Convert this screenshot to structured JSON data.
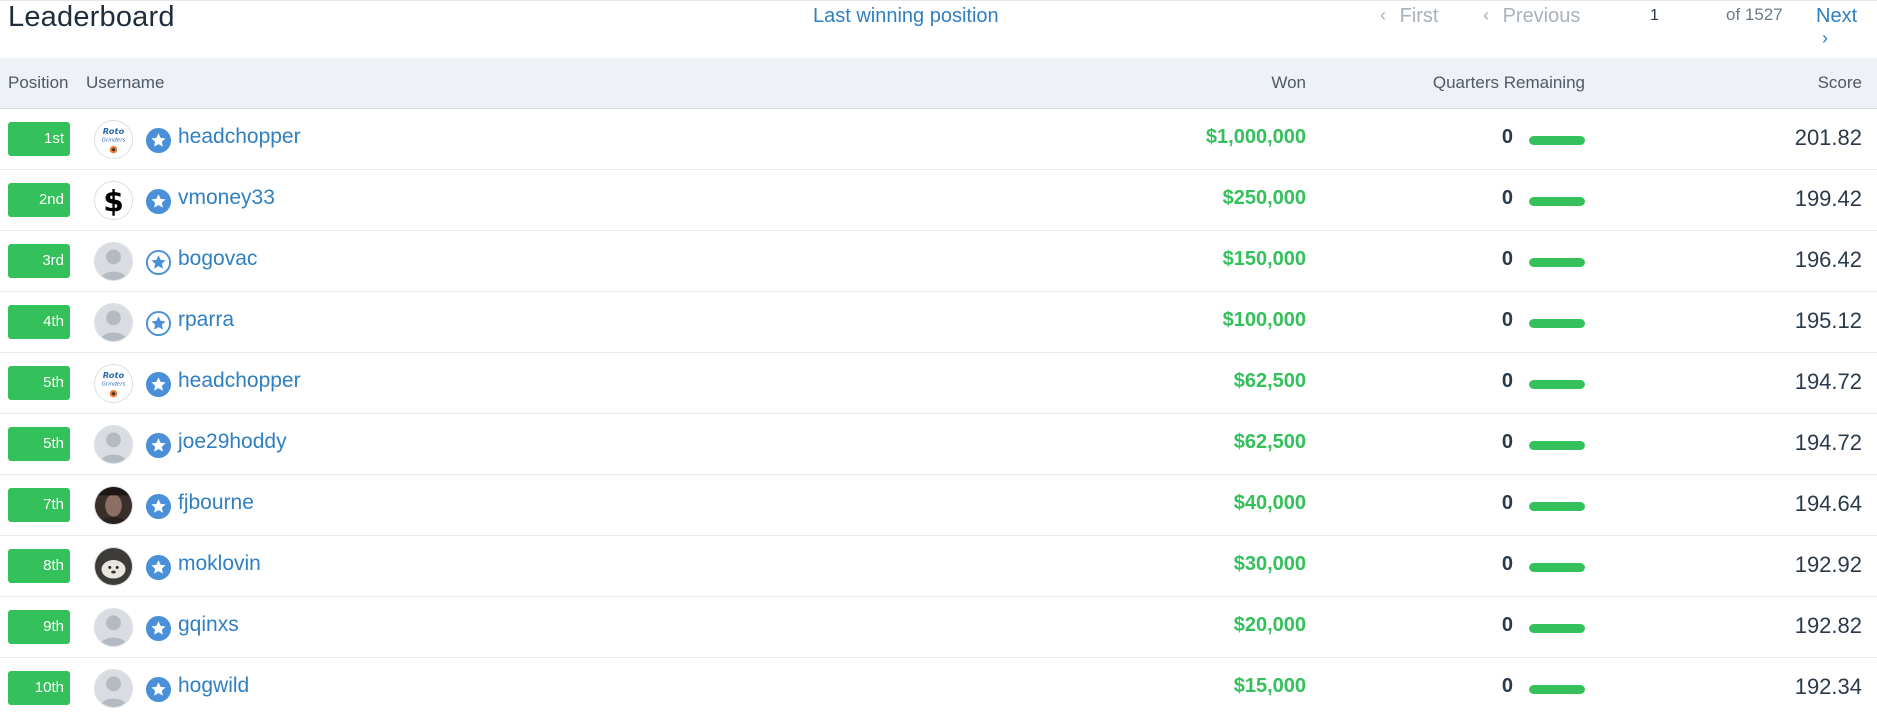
{
  "header": {
    "title": "Leaderboard",
    "last_winning_position": "Last winning position",
    "first_label": "First",
    "previous_label": "Previous",
    "page_value": "1",
    "of_label": "of 1527",
    "next_label": "Next"
  },
  "columns": {
    "position": "Position",
    "username": "Username",
    "won": "Won",
    "quarters_remaining": "Quarters Remaining",
    "score": "Score"
  },
  "colors": {
    "accent_green": "#34c05a",
    "link_blue": "#2f7fc1",
    "header_bg": "#eef1f5"
  },
  "icons": {
    "previous": "chevron-left-icon",
    "next": "chevron-right-icon",
    "member_badge": "star-badge-icon"
  },
  "rows": [
    {
      "position": "1st",
      "avatar": "rotogrinders-logo",
      "star": "filled",
      "username": "headchopper",
      "won": "$1,000,000",
      "quarters": "0",
      "quarters_fill": 1.0,
      "score": "201.82"
    },
    {
      "position": "2nd",
      "avatar": "dollar-sign",
      "star": "filled",
      "username": "vmoney33",
      "won": "$250,000",
      "quarters": "0",
      "quarters_fill": 1.0,
      "score": "199.42"
    },
    {
      "position": "3rd",
      "avatar": "default-user",
      "star": "outline",
      "username": "bogovac",
      "won": "$150,000",
      "quarters": "0",
      "quarters_fill": 1.0,
      "score": "196.42"
    },
    {
      "position": "4th",
      "avatar": "default-user",
      "star": "outline",
      "username": "rparra",
      "won": "$100,000",
      "quarters": "0",
      "quarters_fill": 1.0,
      "score": "195.12"
    },
    {
      "position": "5th",
      "avatar": "rotogrinders-logo",
      "star": "filled",
      "username": "headchopper",
      "won": "$62,500",
      "quarters": "0",
      "quarters_fill": 1.0,
      "score": "194.72"
    },
    {
      "position": "5th",
      "avatar": "default-user",
      "star": "filled",
      "username": "joe29hoddy",
      "won": "$62,500",
      "quarters": "0",
      "quarters_fill": 1.0,
      "score": "194.72"
    },
    {
      "position": "7th",
      "avatar": "photo-dark",
      "star": "filled",
      "username": "fjbourne",
      "won": "$40,000",
      "quarters": "0",
      "quarters_fill": 1.0,
      "score": "194.64"
    },
    {
      "position": "8th",
      "avatar": "photo-dog",
      "star": "filled",
      "username": "moklovin",
      "won": "$30,000",
      "quarters": "0",
      "quarters_fill": 1.0,
      "score": "192.92"
    },
    {
      "position": "9th",
      "avatar": "default-user",
      "star": "filled",
      "username": "gqinxs",
      "won": "$20,000",
      "quarters": "0",
      "quarters_fill": 1.0,
      "score": "192.82"
    },
    {
      "position": "10th",
      "avatar": "default-user",
      "star": "filled",
      "username": "hogwild",
      "won": "$15,000",
      "quarters": "0",
      "quarters_fill": 1.0,
      "score": "192.34"
    }
  ]
}
